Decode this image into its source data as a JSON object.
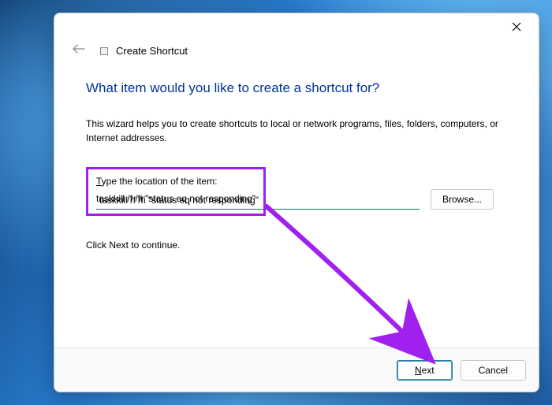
{
  "header": {
    "wizard_title": "Create Shortcut"
  },
  "main": {
    "heading": "What item would you like to create a shortcut for?",
    "description": "This wizard helps you to create shortcuts to local or network programs, files, folders, computers, or Internet addresses.",
    "field_label_prefix": "T",
    "field_label_rest": "ype the location of the item:",
    "location_value": "taskkill /f /fi \"status eq not responding\"",
    "browse_label": "Browse...",
    "continue_text": "Click Next to continue."
  },
  "footer": {
    "next_prefix": "N",
    "next_rest": "ext",
    "cancel_label": "Cancel"
  },
  "annotation": {
    "highlight_color": "#a020f0",
    "arrow_color": "#a020f0"
  }
}
